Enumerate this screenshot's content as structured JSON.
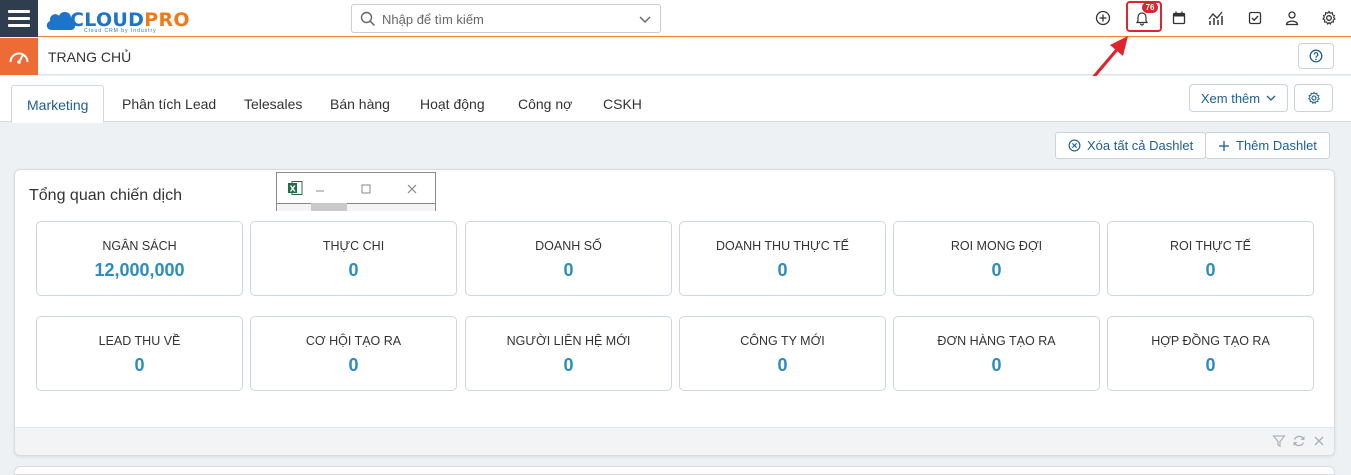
{
  "header": {
    "logo": {
      "text_part1": "CLOUD",
      "text_part2": "PRO",
      "tagline": "Cloud CRM by Industry"
    },
    "search": {
      "placeholder": "Nhập để tìm kiếm"
    },
    "notifications": {
      "count": "76"
    },
    "icons": [
      "plus-circle-icon",
      "bell-icon",
      "calendar-icon",
      "chart-icon",
      "checkbox-icon",
      "user-icon",
      "gear-icon"
    ]
  },
  "subheader": {
    "title": "TRANG CHỦ"
  },
  "tabs": [
    {
      "label": "Marketing",
      "active": true
    },
    {
      "label": "Phân tích Lead"
    },
    {
      "label": "Telesales"
    },
    {
      "label": "Bán hàng"
    },
    {
      "label": "Hoạt động"
    },
    {
      "label": "Công nợ"
    },
    {
      "label": "CSKH"
    }
  ],
  "tab_actions": {
    "more_label": "Xem thêm"
  },
  "dashlet_actions": {
    "clear_label": "Xóa tất cả Dashlet",
    "add_label": "Thêm Dashlet"
  },
  "dashlet": {
    "title": "Tổng quan chiến dịch",
    "cards": [
      {
        "label": "NGÂN SÁCH",
        "value": "12,000,000"
      },
      {
        "label": "THỰC CHI",
        "value": "0"
      },
      {
        "label": "DOANH SỐ",
        "value": "0"
      },
      {
        "label": "DOANH THU THỰC TẾ",
        "value": "0"
      },
      {
        "label": "ROI MONG ĐỢI",
        "value": "0"
      },
      {
        "label": "ROI THỰC TẾ",
        "value": "0"
      },
      {
        "label": "LEAD THU VỀ",
        "value": "0"
      },
      {
        "label": "CƠ HỘI TẠO RA",
        "value": "0"
      },
      {
        "label": "NGƯỜI LIÊN HỆ MỚI",
        "value": "0"
      },
      {
        "label": "CÔNG TY MỚI",
        "value": "0"
      },
      {
        "label": "ĐƠN HÀNG TẠO RA",
        "value": "0"
      },
      {
        "label": "HỢP ĐỒNG TẠO RA",
        "value": "0"
      }
    ]
  },
  "colors": {
    "accent": "#1d5e94",
    "value": "#2b8cc4",
    "orange": "#ef6b35",
    "alert": "#e0242f"
  }
}
